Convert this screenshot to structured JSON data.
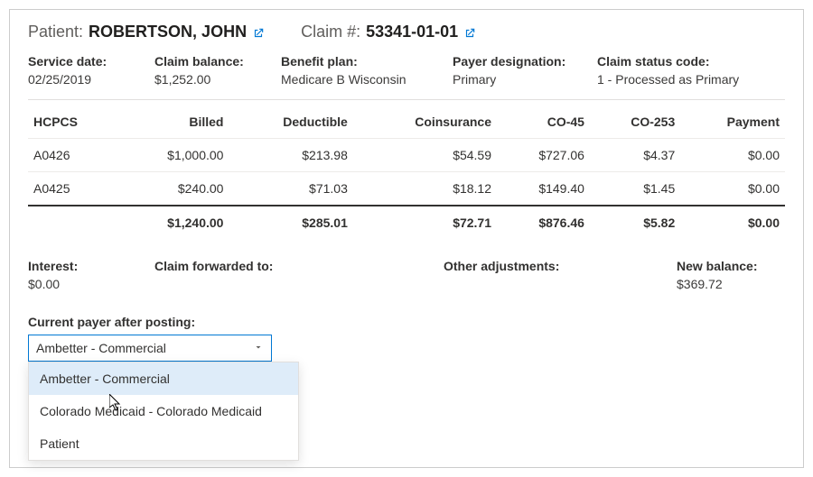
{
  "header": {
    "patient_label": "Patient:",
    "patient_name": "ROBERTSON, JOHN",
    "claim_label": "Claim #:",
    "claim_number": "53341-01-01"
  },
  "info": {
    "service_date_label": "Service date:",
    "service_date": "02/25/2019",
    "claim_balance_label": "Claim balance:",
    "claim_balance": "$1,252.00",
    "benefit_plan_label": "Benefit plan:",
    "benefit_plan": "Medicare B Wisconsin",
    "payer_designation_label": "Payer designation:",
    "payer_designation": "Primary",
    "claim_status_label": "Claim status code:",
    "claim_status": "1 - Processed as Primary"
  },
  "columns": {
    "hcpcs": "HCPCS",
    "billed": "Billed",
    "deductible": "Deductible",
    "coinsurance": "Coinsurance",
    "co45": "CO-45",
    "co253": "CO-253",
    "payment": "Payment"
  },
  "rows": [
    {
      "hcpcs": "A0426",
      "billed": "$1,000.00",
      "deductible": "$213.98",
      "coinsurance": "$54.59",
      "co45": "$727.06",
      "co253": "$4.37",
      "payment": "$0.00"
    },
    {
      "hcpcs": "A0425",
      "billed": "$240.00",
      "deductible": "$71.03",
      "coinsurance": "$18.12",
      "co45": "$149.40",
      "co253": "$1.45",
      "payment": "$0.00"
    }
  ],
  "totals": {
    "billed": "$1,240.00",
    "deductible": "$285.01",
    "coinsurance": "$72.71",
    "co45": "$876.46",
    "co253": "$5.82",
    "payment": "$0.00"
  },
  "footer": {
    "interest_label": "Interest:",
    "interest": "$0.00",
    "forwarded_label": "Claim forwarded to:",
    "forwarded": "",
    "other_adj_label": "Other adjustments:",
    "other_adj": "",
    "new_balance_label": "New balance:",
    "new_balance": "$369.72"
  },
  "dropdown": {
    "label": "Current payer after posting:",
    "selected": "Ambetter - Commercial",
    "options": [
      "Ambetter - Commercial",
      "Colorado Medicaid - Colorado Medicaid",
      "Patient"
    ]
  }
}
